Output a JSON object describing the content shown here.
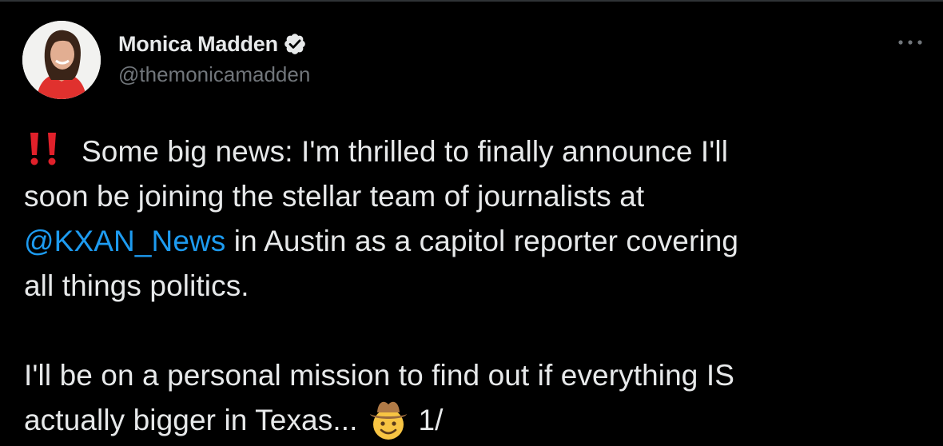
{
  "user": {
    "display_name": "Monica Madden",
    "handle": "@themonicamadden",
    "verified": true,
    "avatar_icon": "profile-photo"
  },
  "menu_icon": "more-options-icon",
  "tweet": {
    "line1_text": "Some big news: I'm thrilled to finally announce I'll",
    "line1_icon": "double-exclamation-emoji",
    "line2": "soon be joining the stellar team of journalists at",
    "mention": "@KXAN_News",
    "line3_rest": " in Austin as a capitol reporter covering",
    "line4": "all things politics.",
    "line5": "I'll be on a personal mission to find out if everything IS",
    "line6_text": "actually bigger in Texas...",
    "line6_icon": "cowboy-hat-face-emoji",
    "line6_suffix": "1/"
  },
  "colors": {
    "background": "#000000",
    "text": "#e7e9ea",
    "secondary": "#71767b",
    "link": "#1d9bf0",
    "verified": "#e7e9ea",
    "emoji_red": "#e0202a"
  }
}
